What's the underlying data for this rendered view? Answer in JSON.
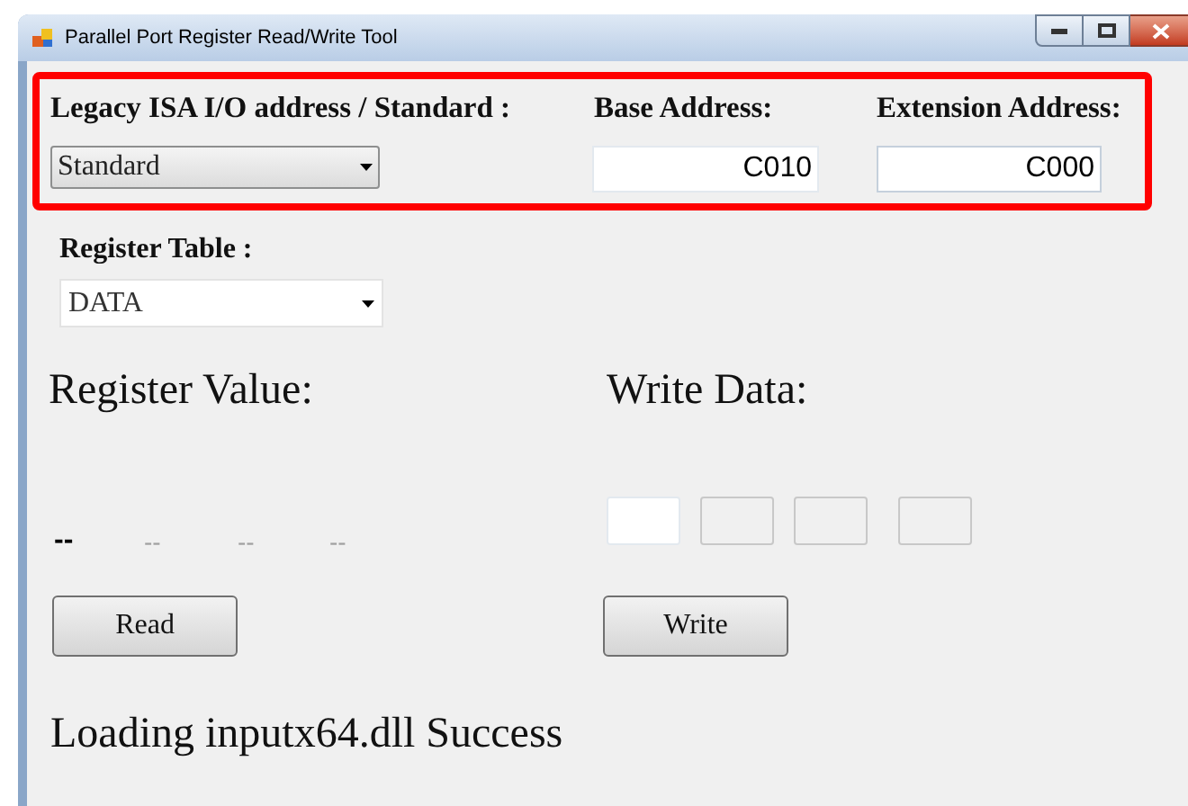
{
  "window": {
    "title": "Parallel Port Register Read/Write Tool"
  },
  "address_panel": {
    "highlighted": true,
    "mode_label": "Legacy ISA I/O address / Standard :",
    "mode_dropdown": {
      "value": "Standard"
    },
    "base_label": "Base Address:",
    "base_field": {
      "value": "C010"
    },
    "extension_label": "Extension Address:",
    "extension_field": {
      "value": "C000"
    }
  },
  "register_table": {
    "label": "Register Table :",
    "dropdown": {
      "value": "DATA"
    }
  },
  "register_value": {
    "label": "Register Value:",
    "bytes": [
      {
        "text": "--",
        "disabled": false
      },
      {
        "text": "--",
        "disabled": true
      },
      {
        "text": "--",
        "disabled": true
      },
      {
        "text": "--",
        "disabled": true
      }
    ]
  },
  "write_data": {
    "label": "Write Data:",
    "fields": [
      {
        "disabled": false
      },
      {
        "disabled": true
      },
      {
        "disabled": true
      },
      {
        "disabled": true
      }
    ]
  },
  "read_button": "Read",
  "write_button": "Write",
  "status": "Loading inputx64.dll Success"
}
